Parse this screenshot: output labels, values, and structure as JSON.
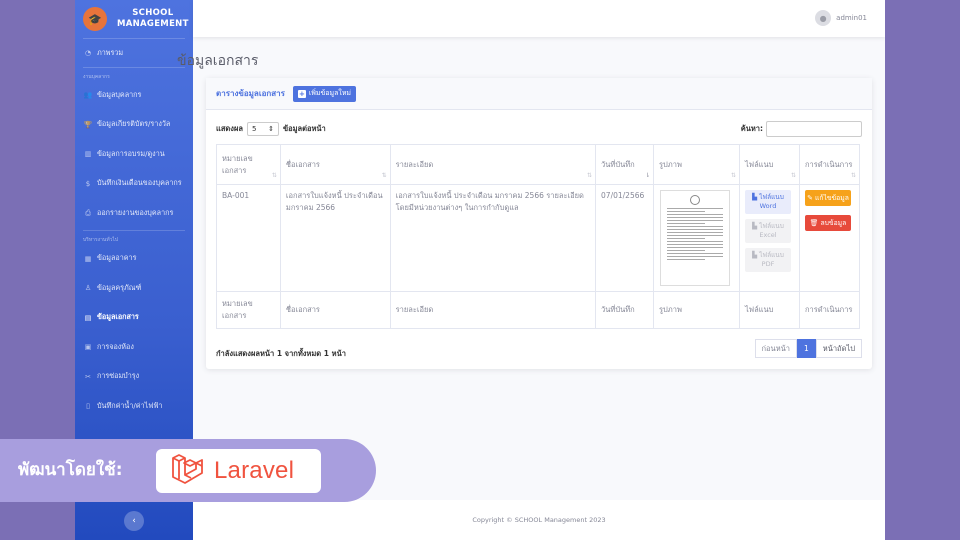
{
  "brand": {
    "line1": "SCHOOL",
    "line2": "MANAGEMENT",
    "logo_icon": "graduation-cap-icon"
  },
  "sidebar": {
    "overview": {
      "icon": "gauge-icon",
      "label": "ภาพรวม"
    },
    "heading_personnel": "งานบุคลากร",
    "personnel_items": [
      {
        "icon": "users-icon",
        "label": "ข้อมูลบุคลากร"
      },
      {
        "icon": "trophy-icon",
        "label": "ข้อมูลเกียรติบัตร/รางวัล"
      },
      {
        "icon": "training-icon",
        "label": "ข้อมูลการอบรม/ดูงาน"
      },
      {
        "icon": "dollar-icon",
        "label": "บันทึกเงินเดือนของบุคลากร"
      },
      {
        "icon": "print-icon",
        "label": "ออกรายงานของบุคลากร"
      }
    ],
    "heading_general": "บริหารงานทั่วไป",
    "general_items": [
      {
        "icon": "building-icon",
        "label": "ข้อมูลอาคาร"
      },
      {
        "icon": "equipment-icon",
        "label": "ข้อมูลครุภัณฑ์"
      },
      {
        "icon": "document-icon",
        "label": "ข้อมูลเอกสาร",
        "active": true
      },
      {
        "icon": "room-icon",
        "label": "การจองห้อง"
      },
      {
        "icon": "tools-icon",
        "label": "การซ่อมบำรุง"
      },
      {
        "icon": "bill-icon",
        "label": "บันทึกค่าน้ำ/ค่าไฟฟ้า"
      }
    ]
  },
  "topbar": {
    "username": "admin01",
    "avatar_icon": "user-avatar-icon"
  },
  "page": {
    "title": "ข้อมูลเอกสาร"
  },
  "card": {
    "title": "ตารางข้อมูลเอกสาร",
    "add_button": "เพิ่มข้อมูลใหม่",
    "length_prefix": "แสดงผล",
    "length_value": "5",
    "length_suffix": "ข้อมูลต่อหน้า",
    "search_label": "ค้นหา:"
  },
  "table": {
    "headers": [
      "หมายเลขเอกสาร",
      "ชื่อเอกสาร",
      "รายละเอียด",
      "วันที่บันทึก",
      "รูปภาพ",
      "ไฟล์แนบ",
      "การดำเนินการ"
    ],
    "footers": [
      "หมายเลขเอกสาร",
      "ชื่อเอกสาร",
      "รายละเอียด",
      "วันที่บันทึก",
      "รูปภาพ",
      "ไฟล์แนบ",
      "การดำเนินการ"
    ],
    "rows": [
      {
        "doc_no": "BA-001",
        "name": "เอกสารใบแจ้งหนี้ ประจำเดือน มกราคม 2566",
        "detail": "เอกสารใบแจ้งหนี้ ประจำเดือน มกราคม 2566 รายละเอียด โดยมีหน่วยงานต่างๆ ในการกำกับดูแล",
        "date": "07/01/2566",
        "file_word": "ไฟล์แนบ Word",
        "file_excel": "ไฟล์แนบ Excel",
        "file_pdf": "ไฟล์แนบ PDF",
        "edit": "แก้ไขข้อมูล",
        "delete": "ลบข้อมูล"
      }
    ]
  },
  "pagination": {
    "info": "กำลังแสดงผลหน้า 1 จากทั้งหมด 1 หน้า",
    "prev": "ก่อนหน้า",
    "current": "1",
    "next": "หน้าถัดไป"
  },
  "footer": {
    "copyright": "Copyright © SCHOOL Management 2023"
  },
  "banner": {
    "text": "พัฒนาโดยใช้:",
    "laravel": "Laravel",
    "laravel_color": "#f0533f"
  }
}
